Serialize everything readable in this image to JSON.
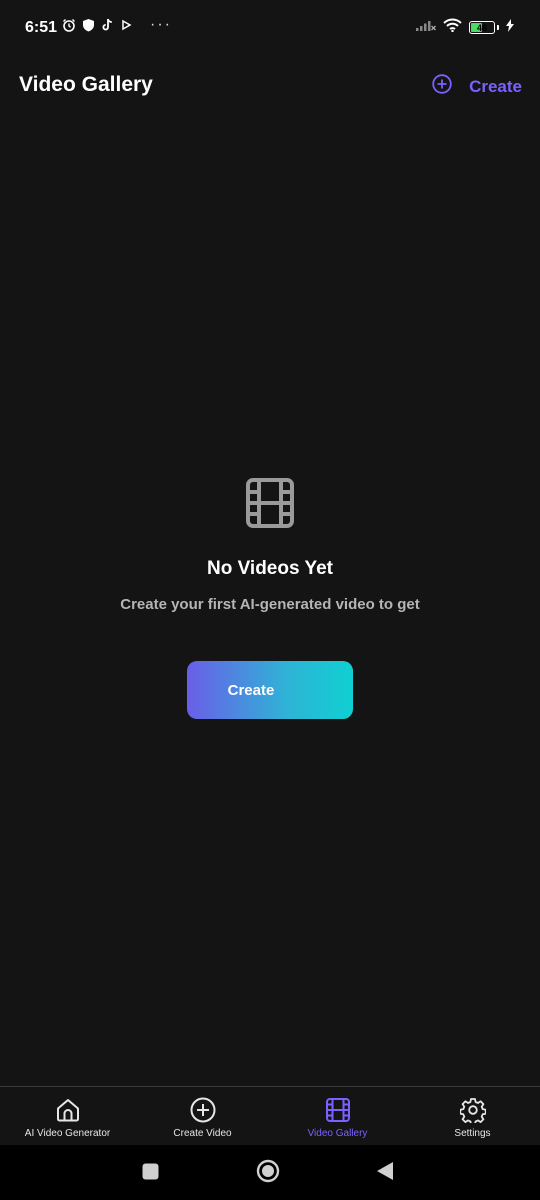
{
  "status_bar": {
    "time": "6:51",
    "more_indicator": "···",
    "battery_level": "46",
    "icons": [
      "alarm-icon",
      "shield-icon",
      "tiktok-icon",
      "play-icon",
      "signal-icon",
      "wifi-icon",
      "battery-icon",
      "charging-icon"
    ]
  },
  "app_bar": {
    "title": "Video Gallery",
    "action_label": "Create",
    "action_icon": "plus-circle-icon"
  },
  "empty_state": {
    "icon": "film-icon",
    "title": "No Videos Yet",
    "subtitle": "Create your first AI-generated video to get",
    "button_label": "Create"
  },
  "bottom_nav": {
    "items": [
      {
        "label": "AI Video Generator",
        "icon": "home-icon",
        "active": false
      },
      {
        "label": "Create Video",
        "icon": "plus-circle-icon",
        "active": false
      },
      {
        "label": "Video Gallery",
        "icon": "film-icon",
        "active": true
      },
      {
        "label": "Settings",
        "icon": "gear-icon",
        "active": false
      }
    ]
  },
  "colors": {
    "background": "#141414",
    "accent": "#7b61ff",
    "gradient_start": "#6a5ee8",
    "gradient_end": "#0fd0d2"
  }
}
